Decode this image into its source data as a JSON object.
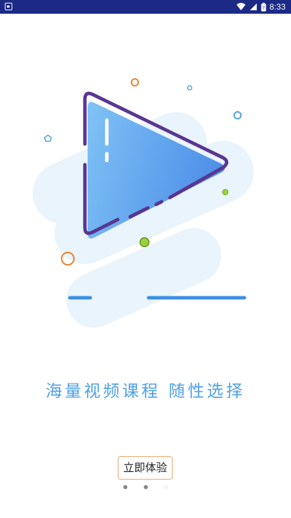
{
  "status_bar": {
    "time": "8:33",
    "icons": [
      "notification-icon",
      "wifi-icon",
      "signal-icon",
      "battery-icon"
    ],
    "background": "#1c2a86"
  },
  "illustration": {
    "icon": "play-icon",
    "accent": "#4fa0e8",
    "outline": "#5a3591"
  },
  "slogan": "海量视频课程  随性选择",
  "start_button": {
    "label": "立即体验",
    "border": "#f0a266"
  },
  "page_indicator": {
    "count": 3,
    "active": 0
  }
}
